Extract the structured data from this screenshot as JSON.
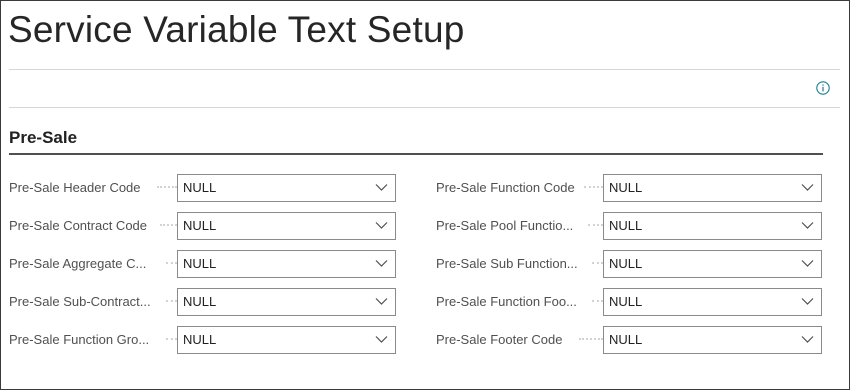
{
  "page": {
    "title": "Service Variable Text Setup"
  },
  "info_button": {
    "icon": "info-icon",
    "color": "#1b7d8f"
  },
  "section": {
    "title": "Pre-Sale"
  },
  "fields": {
    "left": [
      {
        "label": "Pre-Sale Header Code",
        "value": "NULL"
      },
      {
        "label": "Pre-Sale Contract Code",
        "value": "NULL"
      },
      {
        "label": "Pre-Sale Aggregate C...",
        "value": "NULL"
      },
      {
        "label": "Pre-Sale Sub-Contract...",
        "value": "NULL"
      },
      {
        "label": "Pre-Sale Function Gro...",
        "value": "NULL"
      }
    ],
    "right": [
      {
        "label": "Pre-Sale Function Code",
        "value": "NULL"
      },
      {
        "label": "Pre-Sale Pool Functio...",
        "value": "NULL"
      },
      {
        "label": "Pre-Sale Sub Function...",
        "value": "NULL"
      },
      {
        "label": "Pre-Sale Function Foo...",
        "value": "NULL"
      },
      {
        "label": "Pre-Sale Footer Code",
        "value": "NULL"
      }
    ]
  }
}
